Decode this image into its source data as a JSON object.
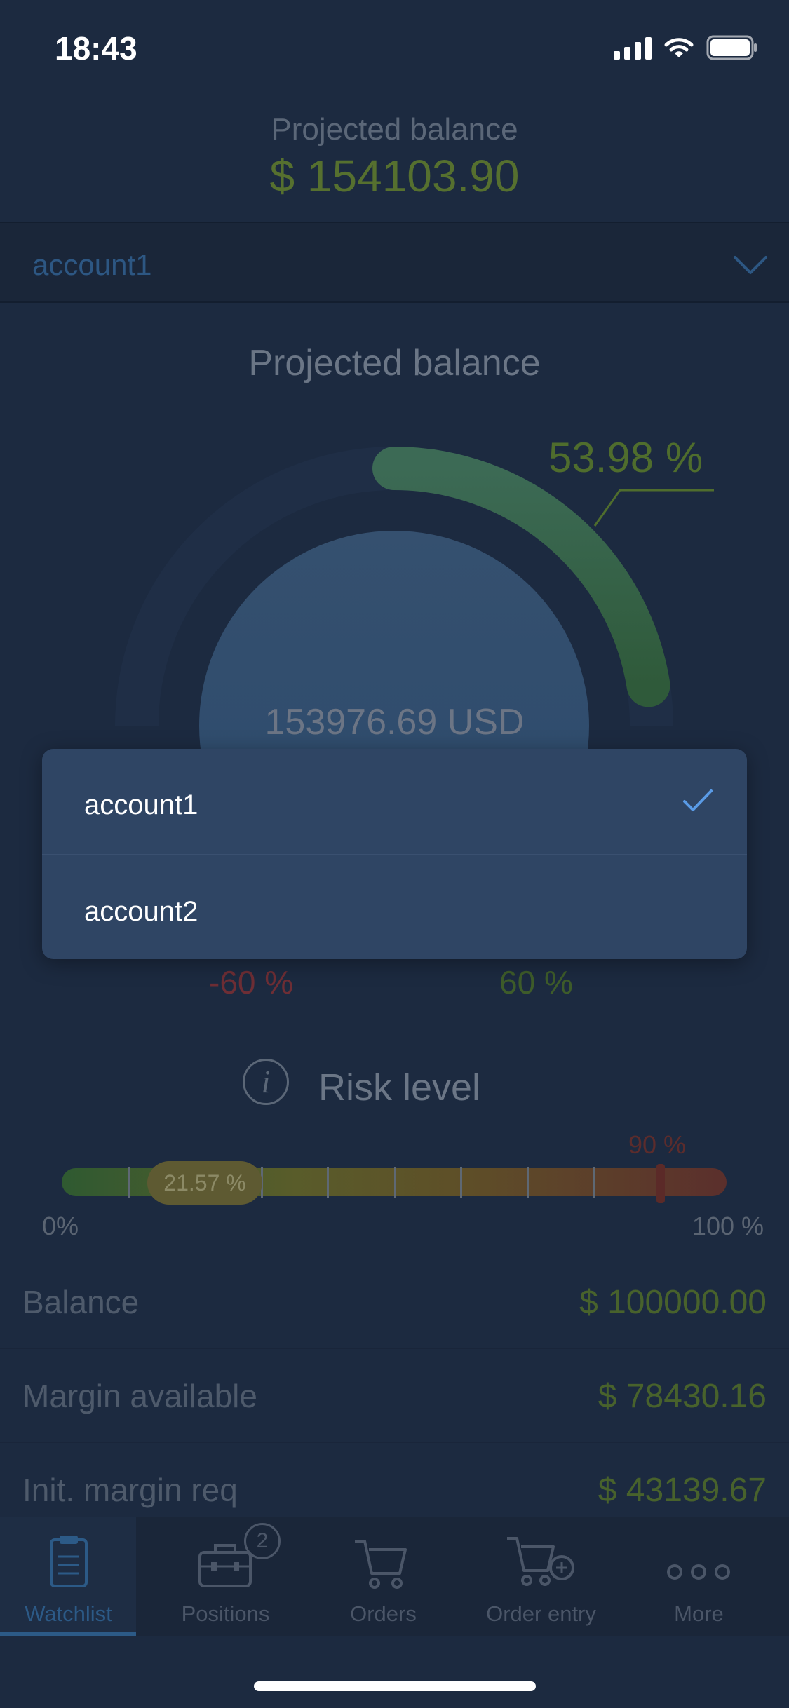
{
  "status_bar": {
    "time": "18:43"
  },
  "header": {
    "title": "Projected balance",
    "balance": "$ 154103.90"
  },
  "account_selector": {
    "selected": "account1"
  },
  "projection": {
    "title": "Projected balance",
    "center_value": "153976.69 USD",
    "percent_label": "53.98 %",
    "percent": 53.98,
    "range_low": "-60 %",
    "range_high": "60 %"
  },
  "risk": {
    "label": "Risk level",
    "info_icon": "i",
    "current_label": "21.57 %",
    "current": 21.57,
    "threshold_label": "90 %",
    "threshold": 90,
    "min_label": "0%",
    "max_label": "100 %"
  },
  "stats": [
    {
      "label": "Balance",
      "value": "$ 100000.00"
    },
    {
      "label": "Margin available",
      "value": "$ 78430.16"
    },
    {
      "label": "Init. margin req",
      "value": "$ 43139.67"
    }
  ],
  "dropdown": {
    "items": [
      {
        "label": "account1",
        "selected": true
      },
      {
        "label": "account2",
        "selected": false
      }
    ]
  },
  "tab_bar": {
    "tabs": [
      {
        "label": "Watchlist",
        "icon": "clipboard-icon",
        "active": true
      },
      {
        "label": "Positions",
        "icon": "briefcase-icon",
        "badge": "2"
      },
      {
        "label": "Orders",
        "icon": "cart-icon"
      },
      {
        "label": "Order entry",
        "icon": "cart-plus-icon"
      },
      {
        "label": "More",
        "icon": "more-dots-icon"
      }
    ]
  },
  "colors": {
    "background": "#1c2a40",
    "accent_blue": "#2c5a87",
    "positive_green": "#48622c",
    "negative_red": "#6e2e35",
    "dropdown_bg": "#2f4564",
    "check_blue": "#5a9be6"
  }
}
